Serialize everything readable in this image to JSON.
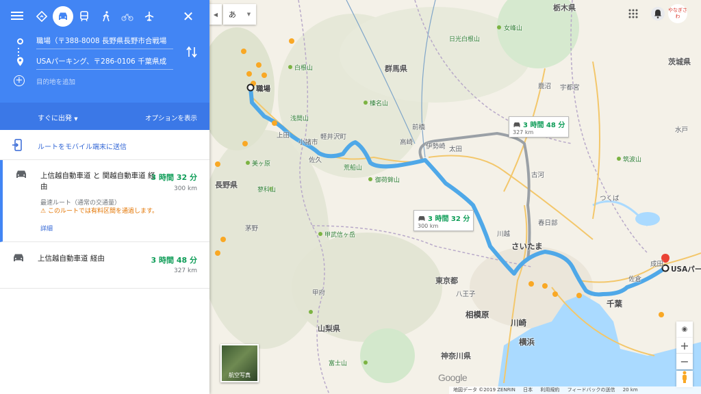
{
  "panel": {
    "stops": {
      "origin": "職場（〒388-8008 長野県長野市合戦場",
      "destination": "USAパーキング、〒286-0106 千葉県成",
      "add_placeholder": "目的地を追加"
    },
    "depart_label": "すぐに出発",
    "options_label": "オプションを表示",
    "send_label": "ルートをモバイル端末に送信",
    "routes": [
      {
        "title": "上信越自動車道 と 関越自動車道 経由",
        "time": "3 時間 32 分",
        "distance": "300 km",
        "subtitle": "最速ルート（通常の交通量）",
        "warning": "このルートでは有料区間を通過します。",
        "detail": "詳細"
      },
      {
        "title": "上信越自動車道 経由",
        "time": "3 時間 48 分",
        "distance": "327 km"
      }
    ]
  },
  "map": {
    "lang_label": "あ",
    "avatar_text": "やなぎさわ",
    "origin_label": "職場",
    "dest_label": "USAパー",
    "callouts": [
      {
        "time": "3 時間 48 分",
        "distance": "327 km"
      },
      {
        "time": "3 時間 32 分",
        "distance": "300 km"
      }
    ],
    "prefectures": [
      "群馬県",
      "長野県",
      "東京都",
      "山梨県",
      "神奈川県",
      "栃木県",
      "茨城県",
      "千葉"
    ],
    "cities": [
      "さいたま",
      "相模原",
      "横浜",
      "川崎",
      "八王子",
      "前橋",
      "高崎",
      "川越",
      "成田",
      "つくば",
      "水戸",
      "宇都宮",
      "鹿沼",
      "太田",
      "佐久",
      "小諸市",
      "上田",
      "軽井沢町",
      "伊勢崎",
      "古河",
      "春日部",
      "佐倉",
      "茅野",
      "甲府"
    ],
    "mountains": [
      "白根山",
      "榛名山",
      "浅間山",
      "荒船山",
      "御荷鉾山",
      "美ヶ原",
      "甲武信ヶ岳",
      "筑波山",
      "女峰山",
      "富士山",
      "日光白根山",
      "蓼科山"
    ],
    "satellite_label": "航空写真",
    "google_logo": "Google",
    "footer": [
      "地図データ ©2019 ZENRIN",
      "日本",
      "利用規約",
      "フィードバックの送信",
      "20 km"
    ],
    "colors": {
      "route": "#4fa8e8",
      "route_alt": "#9aa0a6",
      "accent": "#4285f4"
    }
  }
}
